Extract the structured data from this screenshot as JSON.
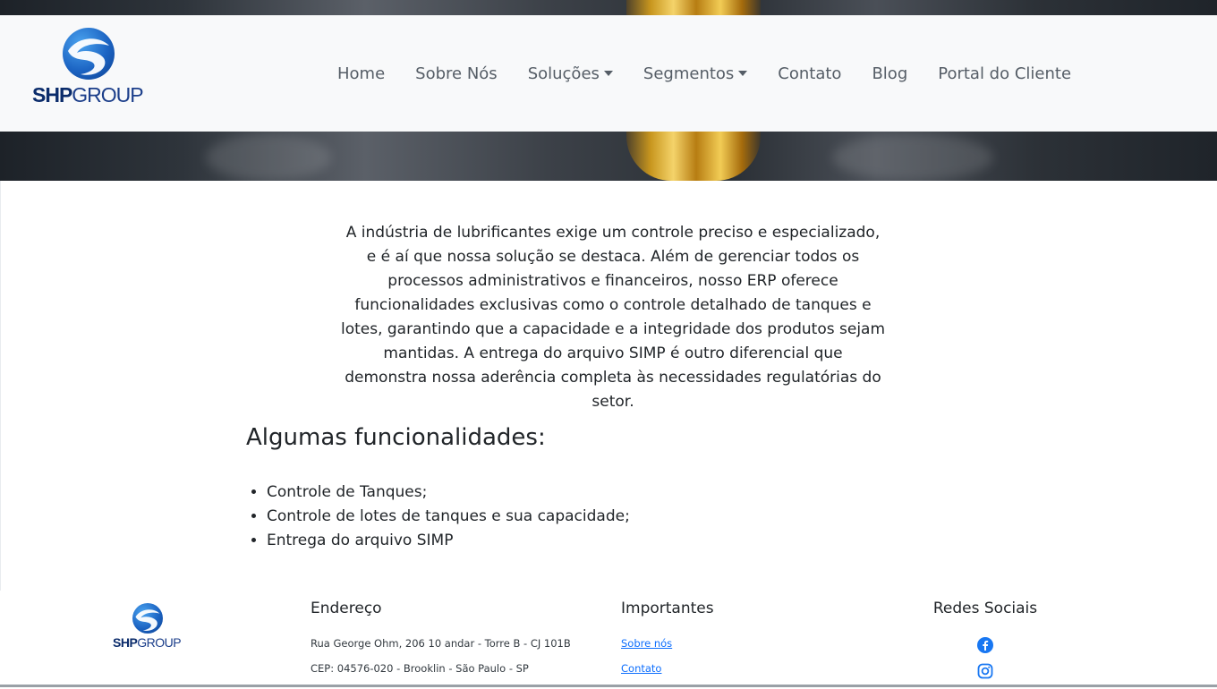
{
  "brand": {
    "logo_text_bold": "SHP",
    "logo_text_light": "GROUP",
    "accent": "#1c64c3"
  },
  "nav": {
    "items": [
      {
        "label": "Home",
        "dropdown": false
      },
      {
        "label": "Sobre Nós",
        "dropdown": false
      },
      {
        "label": "Soluções",
        "dropdown": true
      },
      {
        "label": "Segmentos",
        "dropdown": true
      },
      {
        "label": "Contato",
        "dropdown": false
      },
      {
        "label": "Blog",
        "dropdown": false
      },
      {
        "label": "Portal do Cliente",
        "dropdown": false
      }
    ]
  },
  "main": {
    "intro": "A indústria de lubrificantes exige um controle preciso e especializado, e é aí que nossa solução se destaca. Além de gerenciar todos os processos administrativos e financeiros, nosso ERP oferece funcionalidades exclusivas como o controle detalhado de tanques e lotes, garantindo que a capacidade e a integridade dos produtos sejam mantidas. A entrega do arquivo SIMP é outro diferencial que demonstra nossa aderência completa às necessidades regulatórias do setor.",
    "features_title": "Algumas funcionalidades:",
    "features": [
      "Controle de Tanques;",
      "Controle de lotes de tanques e sua capacidade;",
      "Entrega do arquivo SIMP"
    ]
  },
  "footer": {
    "address": {
      "title": "Endereço",
      "line1": "Rua George Ohm, 206 10 andar - Torre B - CJ 101B",
      "line2": "CEP: 04576-020 - Brooklin - São Paulo - SP"
    },
    "important": {
      "title": "Importantes",
      "links": [
        "Sobre nós",
        "Contato"
      ]
    },
    "social": {
      "title": "Redes Sociais",
      "icons": [
        "facebook-icon",
        "instagram-icon"
      ]
    }
  }
}
